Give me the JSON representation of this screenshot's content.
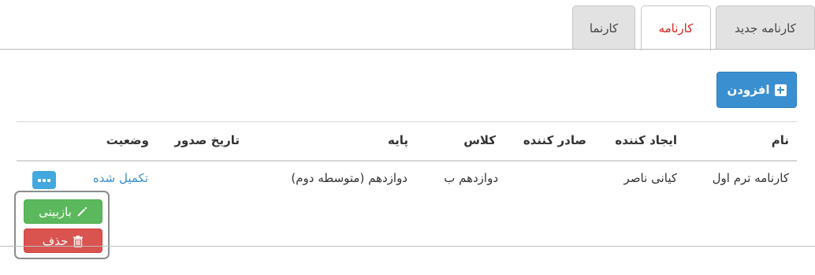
{
  "tabs": [
    {
      "label": "کارنامه جدید",
      "active": false
    },
    {
      "label": "کارنامه",
      "active": true
    },
    {
      "label": "کارنما",
      "active": false
    }
  ],
  "toolbar": {
    "add_label": "افزودن"
  },
  "table": {
    "headers": {
      "name": "نام",
      "creator": "ایجاد کننده",
      "issuer": "صادر کننده",
      "class": "کلاس",
      "grade": "پایه",
      "issue_date": "تاریخ صدور",
      "status": "وضعیت"
    },
    "rows": [
      {
        "name": "کارنامه ترم اول",
        "creator": "کیانی ناصر",
        "issuer": "",
        "class": "دوازدهم ب",
        "grade": "دوازدهم (متوسطه دوم)",
        "issue_date": "",
        "status": "تکمیل شده"
      }
    ]
  },
  "row_actions": {
    "review_label": "بازبینی",
    "delete_label": "حذف"
  },
  "colors": {
    "active_tab_text": "#d9221c",
    "primary": "#3a8fd0",
    "success": "#5cb85c",
    "danger": "#d9534f",
    "info": "#42a8dd"
  },
  "icons": {
    "add": "plus-square-icon",
    "review": "pencil-icon",
    "delete": "trash-icon",
    "actions": "more-dots-icon"
  }
}
